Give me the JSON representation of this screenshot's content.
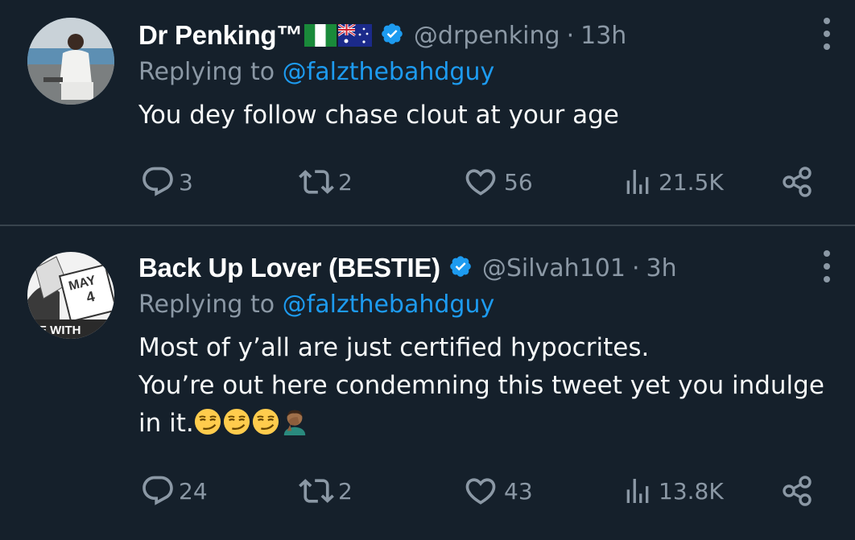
{
  "tweets": [
    {
      "name": "Dr Penking™",
      "flags": [
        "nigeria-flag",
        "australia-flag"
      ],
      "handle": "@drpenking",
      "separator": "·",
      "time": "13h",
      "replying_prefix": "Replying to ",
      "replying_to": "@falzthebahdguy",
      "text_lines": [
        "You dey follow chase clout at your age"
      ],
      "replies": "3",
      "retweets": "2",
      "likes": "56",
      "views": "21.5K"
    },
    {
      "name": "Back Up Lover (BESTIE)",
      "handle": "@Silvah101",
      "separator": "·",
      "time": "3h",
      "replying_prefix": "Replying to ",
      "replying_to": "@falzthebahdguy",
      "text_lines": [
        "Most of y’all are just certified hypocrites.",
        "You’re out here condemning this tweet yet you indulge",
        "in it."
      ],
      "emojis": [
        "smirking-face",
        "smirking-face",
        "smirking-face",
        "man-facepalming"
      ],
      "avatar_text": {
        "top": "MAY",
        "number": "4",
        "bottom": "E WITH"
      },
      "replies": "24",
      "retweets": "2",
      "likes": "43",
      "views": "13.8K"
    }
  ],
  "colors": {
    "background": "#15202b",
    "text": "#f7f9f9",
    "muted": "#8b98a5",
    "accent": "#1d9bf0",
    "divider": "#38444d"
  },
  "icons": [
    "reply-icon",
    "retweet-icon",
    "like-icon",
    "views-icon",
    "share-icon",
    "more-icon",
    "verified-badge-icon"
  ]
}
